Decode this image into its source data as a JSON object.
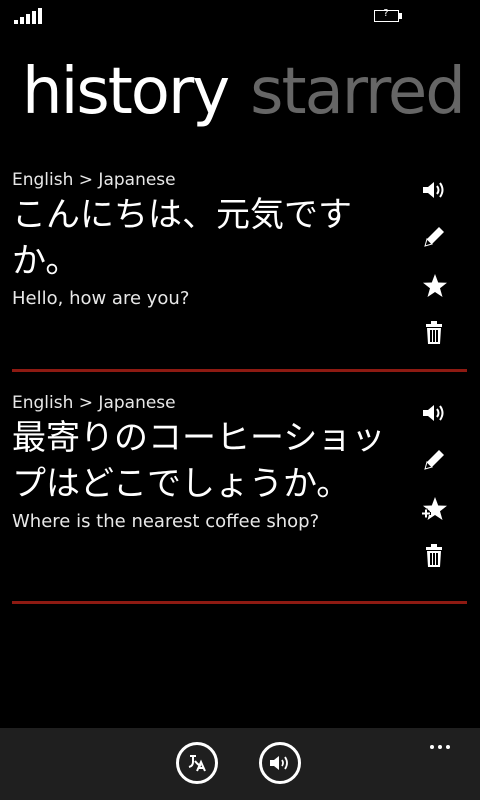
{
  "status": {
    "battery_text": "?"
  },
  "pivot": {
    "active_label": "history",
    "inactive_label": "starred"
  },
  "entries": [
    {
      "lang": "English > Japanese",
      "translation": "こんにちは、元気ですか。",
      "source": "Hello, how are you?",
      "starred": true
    },
    {
      "lang": "English > Japanese",
      "translation": "最寄りのコーヒーショップはどこでしょうか。",
      "source": "Where is the nearest coffee shop?",
      "starred": false
    }
  ],
  "icons": {
    "speak": "speaker-icon",
    "edit": "pencil-icon",
    "star": "star-icon",
    "add_star": "star-add-icon",
    "delete": "trash-icon",
    "camera": "translate-icon",
    "voice": "speaker-icon",
    "more": "more-icon"
  },
  "colors": {
    "accent": "#8e1a12",
    "app_bar": "#1f1f1f",
    "inactive_text": "#666666"
  }
}
